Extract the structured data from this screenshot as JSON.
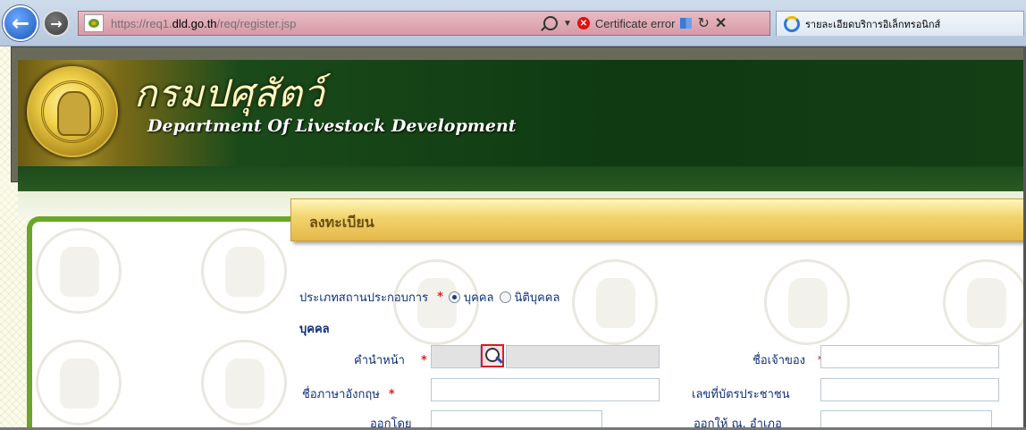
{
  "browser": {
    "url_prefix": "https://req1.",
    "url_domain": "dld.go.th",
    "url_path": "/req/register.jsp",
    "certificate_error": "Certificate error",
    "tab_title": "รายละเอียดบริการอิเล็กทรอนิกส์"
  },
  "banner": {
    "thai_title": "กรมปศุสัตว์",
    "english_title": "Department Of Livestock Development"
  },
  "section": {
    "title": "ลงทะเบียน"
  },
  "form": {
    "business_type_label": "ประเภทสถานประกอบการ",
    "required_mark": "*",
    "option_person": "บุคคล",
    "option_juristic": "นิติบุคคล",
    "selected_option": "บุคคล",
    "person_heading": "บุคคล",
    "title_prefix_label": "คำนำหน้า",
    "owner_name_label": "ชื่อเจ้าของ",
    "english_name_label": "ชื่อภาษาอังกฤษ",
    "id_card_label": "เลขที่บัตรประชาชน",
    "issued_by_label": "ออกโดย",
    "issued_at_label": "ออกให้  ณ. อำเภอ"
  }
}
